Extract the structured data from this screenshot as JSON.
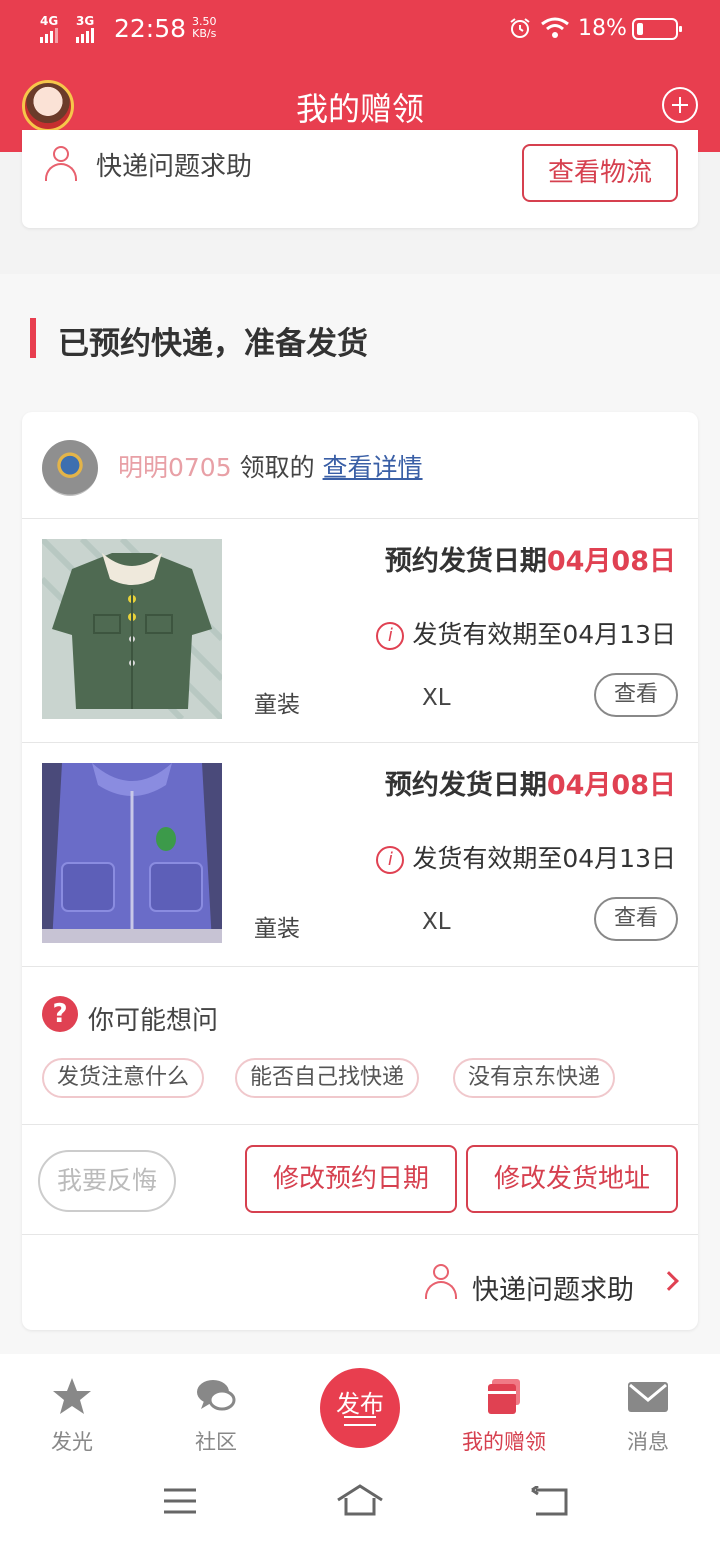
{
  "status_bar": {
    "signal1": "4G",
    "signal2": "3G",
    "time": "22:58",
    "speed_value": "3.50",
    "speed_unit": "KB/s",
    "battery": "18%"
  },
  "header": {
    "title": "我的赠领",
    "avatar_icon": "user-avatar",
    "add_icon": "plus-circle-icon"
  },
  "previous_card": {
    "help_label": "快递问题求助",
    "button_label": "查看物流"
  },
  "section": {
    "title": "已预约快递，准备发货"
  },
  "order": {
    "claimer_name": "明明0705",
    "claimer_verb": "领取的",
    "detail_link": "查看详情",
    "items": [
      {
        "ship_label": "预约发货日期",
        "ship_date": "04月08日",
        "valid_text": "发货有效期至04月13日",
        "info_icon": "i",
        "category": "童装",
        "size": "XL",
        "view_label": "查看",
        "image": "green-corduroy-jacket"
      },
      {
        "ship_label": "预约发货日期",
        "ship_date": "04月08日",
        "valid_text": "发货有效期至04月13日",
        "info_icon": "i",
        "category": "童装",
        "size": "XL",
        "view_label": "查看",
        "image": "purple-hooded-jacket"
      }
    ],
    "faq": {
      "icon": "?",
      "title": "你可能想问",
      "chips": [
        "发货注意什么",
        "能否自己找快递",
        "没有京东快递"
      ]
    },
    "actions": {
      "regret": "我要反悔",
      "modify_date": "修改预约日期",
      "modify_address": "修改发货地址"
    },
    "help_label": "快递问题求助"
  },
  "tabbar": {
    "tabs": [
      {
        "label": "发光",
        "icon": "star-icon"
      },
      {
        "label": "社区",
        "icon": "chat-bubbles-icon"
      },
      {
        "label": "发布",
        "icon": "publish-icon"
      },
      {
        "label": "我的赠领",
        "icon": "gift-box-icon",
        "active": true
      },
      {
        "label": "消息",
        "icon": "mail-icon"
      }
    ]
  },
  "colors": {
    "primary": "#e83e4f",
    "date_red": "#e04152",
    "link_blue": "#3a5fa6"
  }
}
